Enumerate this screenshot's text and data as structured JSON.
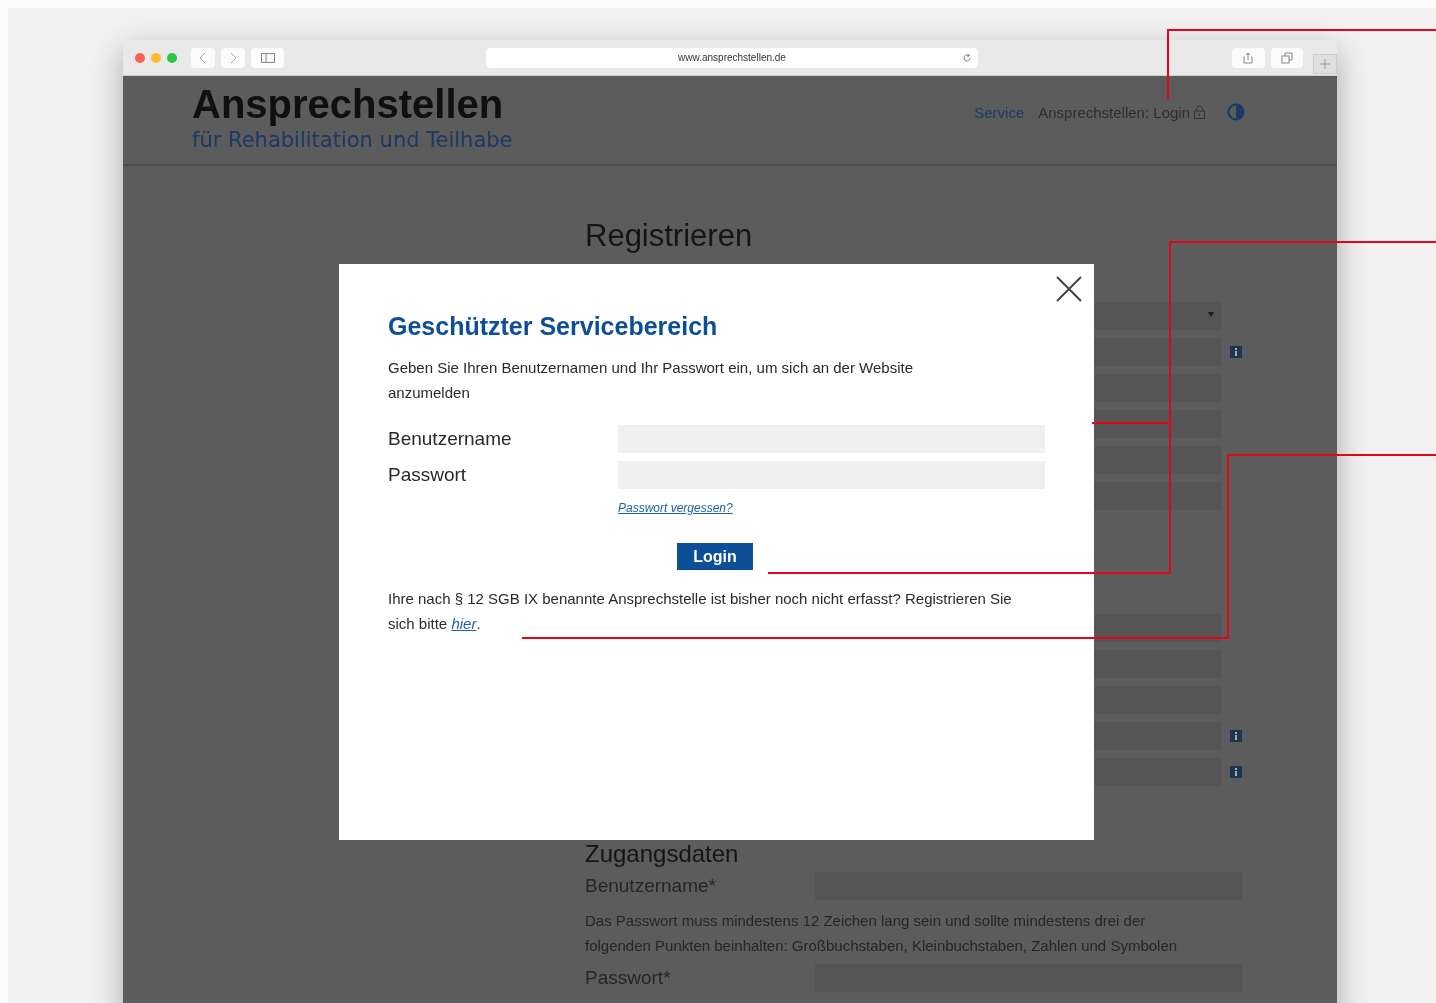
{
  "browser": {
    "url": "www.ansprechstellen.de"
  },
  "header": {
    "title": "Ansprechstellen",
    "subtitle": "für Rehabilitation und Teilhabe",
    "nav": [
      {
        "label": "Service",
        "kind": "link"
      },
      {
        "label": "Ansprechstellen: Login",
        "kind": "login"
      }
    ]
  },
  "page": {
    "title": "Registrieren",
    "form_groups": [
      {
        "fields": [
          {
            "kind": "select"
          },
          {
            "kind": "info"
          },
          {
            "kind": "plain"
          },
          {
            "kind": "plain"
          },
          {
            "kind": "plain"
          },
          {
            "kind": "plain"
          }
        ]
      },
      {
        "fields": [
          {
            "kind": "plain"
          },
          {
            "kind": "plain"
          },
          {
            "kind": "plain"
          },
          {
            "kind": "info"
          },
          {
            "kind": "info"
          }
        ]
      }
    ],
    "section_title": "Zugangsdaten",
    "username_label": "Benutzername*",
    "password_hint": "Das Passwort muss mindestens 12 Zeichen lang sein und sollte mindestens drei der folgenden Punkten beinhalten: Großbuchstaben, Kleinbuchstaben, Zahlen und Symbolen",
    "password_label": "Passwort*"
  },
  "modal": {
    "title": "Geschützter Servicebereich",
    "intro": "Geben Sie Ihren Benutzernamen und Ihr Passwort ein, um sich an der Website anzumelden",
    "fields": [
      {
        "label": "Benutzername"
      },
      {
        "label": "Passwort"
      }
    ],
    "forgot_link": "Passwort vergessen?",
    "button": "Login",
    "footer": {
      "text": "Ihre nach § 12 SGB IX benannte Ansprechstelle ist bisher noch nicht erfasst? Registrieren Sie sich bitte",
      "link": "hier",
      "after": "."
    }
  }
}
